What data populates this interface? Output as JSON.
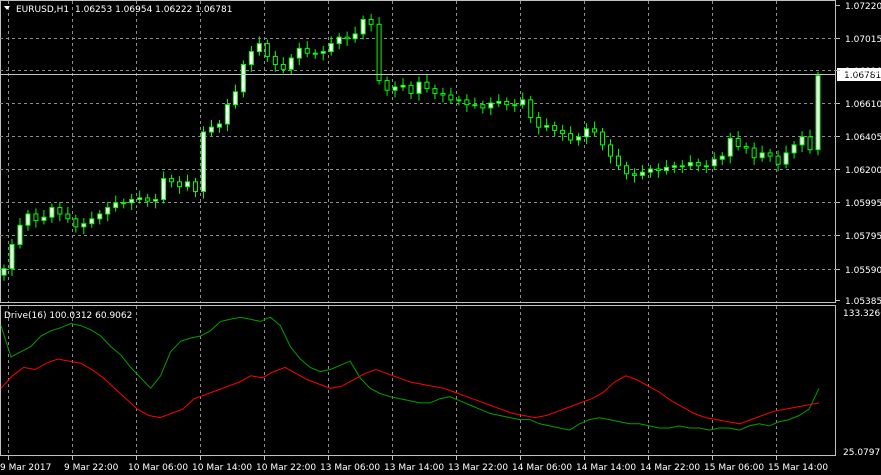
{
  "main_panel": {
    "symbol_timeframe": "EURUSD,H1",
    "ohlc": [
      "1.06253",
      "1.06954",
      "1.06222",
      "1.06781"
    ],
    "price_ticks": [
      "1.07220",
      "1.07015",
      "1.06810",
      "1.06610",
      "1.06405",
      "1.06200",
      "1.05995",
      "1.05795",
      "1.05590",
      "1.05385"
    ],
    "current_price": "1.06781"
  },
  "indicator_panel": {
    "name": "Drive(16)",
    "values": [
      "100.0312",
      "60.9062"
    ],
    "ticks": [
      "133.3266",
      "25.0797"
    ]
  },
  "time_axis": {
    "labels": [
      "9 Mar 2017",
      "9 Mar 22:00",
      "10 Mar 06:00",
      "10 Mar 14:00",
      "10 Mar 22:00",
      "13 Mar 06:00",
      "13 Mar 14:00",
      "13 Mar 22:00",
      "14 Mar 06:00",
      "14 Mar 14:00",
      "14 Mar 22:00",
      "15 Mar 06:00",
      "15 Mar 14:00"
    ]
  },
  "colors": {
    "background": "#000000",
    "grid": "#8c8c8c",
    "candle_bull": "#ffffff",
    "candle_bear": "#000000",
    "candle_outline": "#00ff00",
    "drive_green": "#00a000",
    "drive_red": "#ff0000",
    "axis_text": "#ffffff"
  },
  "chart_data": {
    "type": "candlestick",
    "candles_close": [
      1.0558,
      1.0573,
      1.0585,
      1.0592,
      1.0588,
      1.059,
      1.0596,
      1.0592,
      1.0589,
      1.0584,
      1.0586,
      1.0589,
      1.0592,
      1.0596,
      1.0599,
      1.0599,
      1.0601,
      1.0602,
      1.06,
      1.0601,
      1.0614,
      1.0612,
      1.0609,
      1.0612,
      1.0606,
      1.0643,
      1.0646,
      1.0648,
      1.066,
      1.0668,
      1.0685,
      1.0693,
      1.0698,
      1.069,
      1.0685,
      1.0682,
      1.0689,
      1.0695,
      1.0692,
      1.0692,
      1.0693,
      1.0698,
      1.0702,
      1.0701,
      1.0704,
      1.0713,
      1.071,
      1.0675,
      1.0669,
      1.0671,
      1.0672,
      1.0667,
      1.0674,
      1.067,
      1.0667,
      1.0666,
      1.0663,
      1.0663,
      1.066,
      1.066,
      1.0658,
      1.0661,
      1.0662,
      1.066,
      1.066,
      1.0663,
      1.0652,
      1.0646,
      1.0647,
      1.0644,
      1.0642,
      1.0638,
      1.064,
      1.0645,
      1.0643,
      1.0635,
      1.0628,
      1.0622,
      1.0617,
      1.0616,
      1.0618,
      1.062,
      1.0619,
      1.0621,
      1.0622,
      1.0622,
      1.0624,
      1.0622,
      1.0622,
      1.0626,
      1.0628,
      1.0639,
      1.0634,
      1.0633,
      1.0627,
      1.063,
      1.0628,
      1.0623,
      1.063,
      1.0635,
      1.064,
      1.0632,
      1.0678
    ]
  }
}
